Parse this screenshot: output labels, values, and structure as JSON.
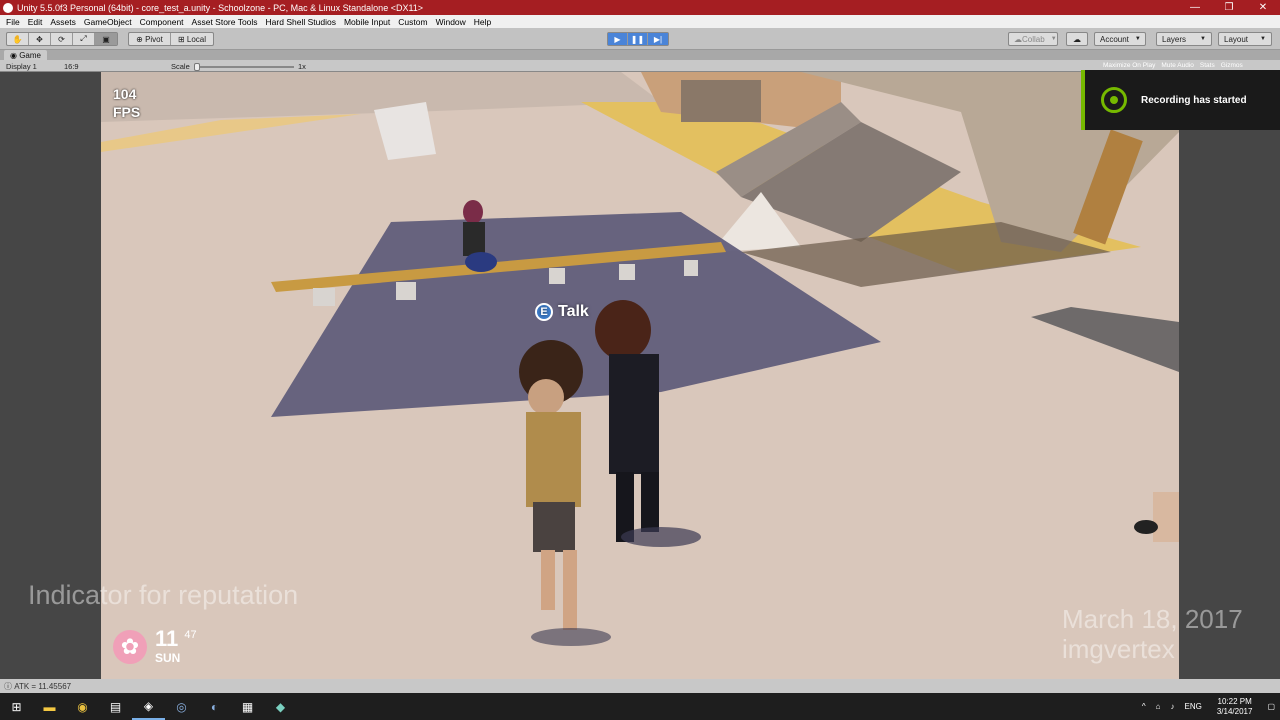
{
  "window": {
    "title": "Unity 5.5.0f3 Personal (64bit) - core_test_a.unity - Schoolzone - PC, Mac & Linux Standalone <DX11>",
    "controls": [
      "—",
      "❐",
      "✕"
    ]
  },
  "menu": [
    "File",
    "Edit",
    "Assets",
    "GameObject",
    "Component",
    "Asset Store Tools",
    "Hard Shell Studios",
    "Mobile Input",
    "Custom",
    "Window",
    "Help"
  ],
  "toolbar": {
    "pivot_label": "Pivot",
    "local_label": "Local",
    "collab_label": "Collab",
    "account_label": "Account",
    "layers_label": "Layers",
    "layout_label": "Layout"
  },
  "game_tab": {
    "tab_label": "Game",
    "display_label": "Display 1",
    "aspect_label": "16:9",
    "scale_label": "Scale",
    "scale_value": "1x",
    "maximize_label": "Maximize On Play",
    "mute_label": "Mute Audio",
    "stats_label": "Stats",
    "gizmos_label": "Gizmos"
  },
  "hud": {
    "fps_value": "104",
    "fps_label": "FPS",
    "interact_key": "E",
    "interact_label": "Talk",
    "day_number": "11",
    "minutes": "47",
    "day_name": "SUN"
  },
  "overlay": {
    "recording_text": "Recording has started",
    "annotation": "Indicator for reputation",
    "watermark_date": "March 18, 2017",
    "watermark_name": "imgvertex"
  },
  "status": {
    "console_line": "ATK = 11.45567"
  },
  "taskbar": {
    "language": "ENG",
    "time": "10:22 PM",
    "date": "3/14/2017"
  },
  "colors": {
    "titlebar": "#a51e22",
    "nvidia_green": "#76b900",
    "play_active": "#4a84d8"
  }
}
